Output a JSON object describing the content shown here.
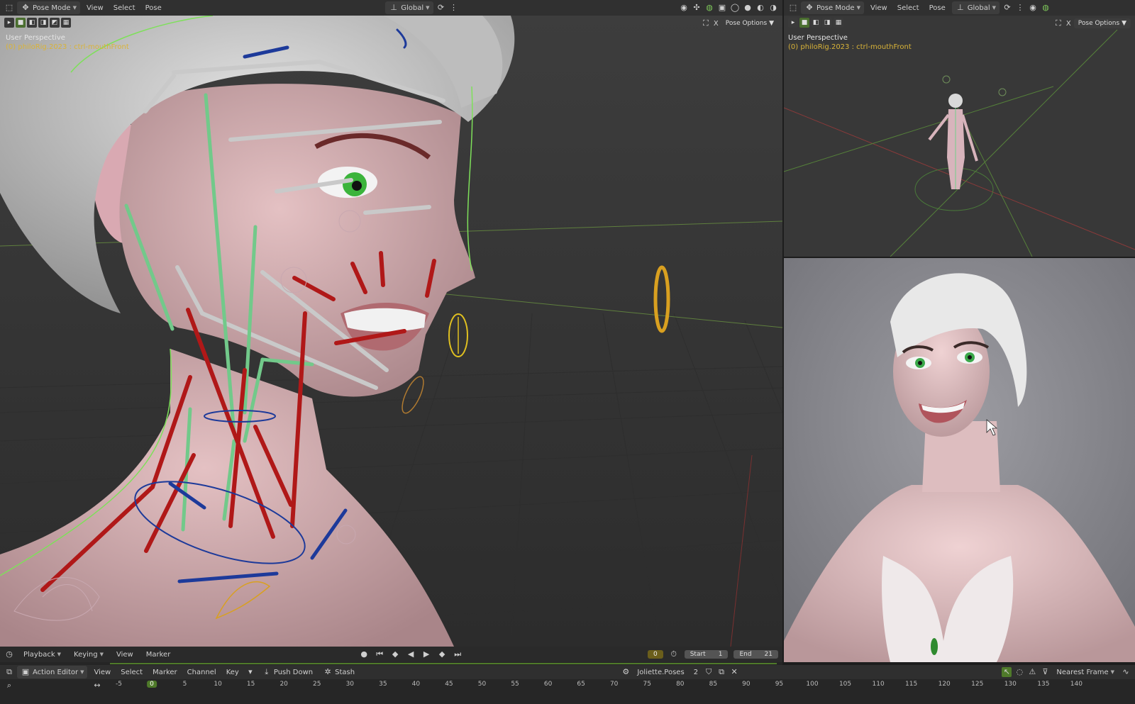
{
  "main_header": {
    "mode": "Pose Mode",
    "menus": [
      "View",
      "Select",
      "Pose"
    ],
    "transform_orientation": "Global"
  },
  "main_viewport": {
    "perspective": "User Perspective",
    "active_object": "(0) philoRig.2023 : ctrl-mouthFront",
    "pose_options": "Pose Options",
    "xray_label": "X"
  },
  "right_header": {
    "mode": "Pose Mode",
    "menus": [
      "View",
      "Select",
      "Pose"
    ],
    "transform_orientation": "Global"
  },
  "right_viewport": {
    "perspective": "User Perspective",
    "active_object": "(0) philoRig.2023 : ctrl-mouthFront",
    "pose_options": "Pose Options",
    "xray_label": "X"
  },
  "timeline": {
    "menus": [
      "Playback",
      "Keying",
      "View",
      "Marker"
    ],
    "current_frame": "0",
    "start_label": "Start",
    "start_value": "1",
    "end_label": "End",
    "end_value": "21"
  },
  "action_editor": {
    "editor": "Action Editor",
    "menus": [
      "View",
      "Select",
      "Marker",
      "Channel",
      "Key"
    ],
    "push_down": "Push Down",
    "stash": "Stash",
    "action_name": "Joliette.Poses",
    "users": "2",
    "snap": "Nearest Frame"
  },
  "ruler": {
    "current": "0",
    "ticks": [
      "-5",
      "5",
      "10",
      "15",
      "20",
      "25",
      "30",
      "35",
      "40",
      "45",
      "50",
      "55",
      "60",
      "65",
      "70",
      "75",
      "80",
      "85",
      "90",
      "95",
      "100",
      "105",
      "110",
      "115",
      "120",
      "125",
      "130",
      "135",
      "140"
    ]
  },
  "colors": {
    "active_text": "#d9b338",
    "bone_red": "#b01818",
    "bone_green": "#6fcf8a",
    "bone_white": "#c8c8c8",
    "bone_blue": "#1d3a9a",
    "controller_yellow": "#e0b020",
    "skin": "#d8b0b4"
  }
}
